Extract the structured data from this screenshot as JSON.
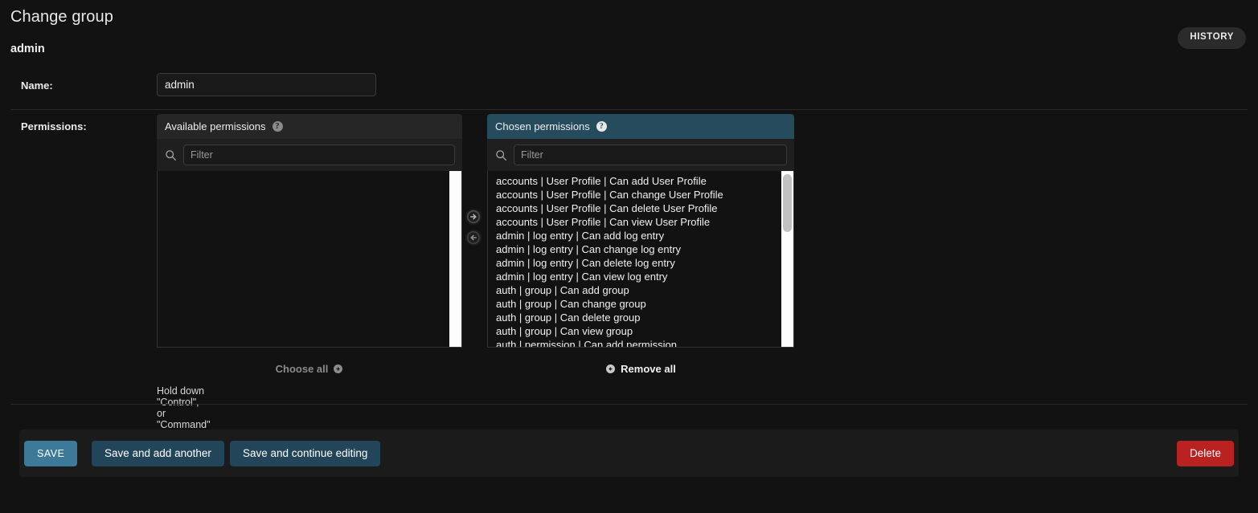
{
  "header": {
    "title": "Change group",
    "history_label": "HISTORY",
    "object_name": "admin"
  },
  "form": {
    "name_label": "Name:",
    "name_value": "admin",
    "permissions_label": "Permissions:"
  },
  "selector": {
    "available": {
      "title": "Available permissions",
      "help_icon": "help-icon",
      "search_icon": "search-icon",
      "filter_placeholder": "Filter",
      "filter_value": "",
      "options": [],
      "footer_label": "Choose all",
      "footer_icon": "arrow-right-circle-icon"
    },
    "chosen": {
      "title": "Chosen permissions",
      "help_icon": "help-icon",
      "search_icon": "search-icon",
      "filter_placeholder": "Filter",
      "filter_value": "",
      "options": [
        "accounts | User Profile | Can add User Profile",
        "accounts | User Profile | Can change User Profile",
        "accounts | User Profile | Can delete User Profile",
        "accounts | User Profile | Can view User Profile",
        "admin | log entry | Can add log entry",
        "admin | log entry | Can change log entry",
        "admin | log entry | Can delete log entry",
        "admin | log entry | Can view log entry",
        "auth | group | Can add group",
        "auth | group | Can change group",
        "auth | group | Can delete group",
        "auth | group | Can view group",
        "auth | permission | Can add permission"
      ],
      "footer_label": "Remove all",
      "footer_icon": "arrow-left-circle-icon"
    },
    "add_button_icon": "arrow-right-circle-icon",
    "remove_button_icon": "arrow-left-circle-icon",
    "help_text": "Hold down \"Control\", or \"Command\" on a Mac, to select more than one."
  },
  "submit_row": {
    "save_label": "SAVE",
    "save_and_add_another_label": "Save and add another",
    "save_and_continue_label": "Save and continue editing",
    "delete_label": "Delete"
  },
  "colors": {
    "page_background": "#121212",
    "chosen_header": "#264b5d",
    "save_button": "#3d7a99",
    "secondary_button": "#22455a",
    "delete_button": "#ba2121"
  }
}
